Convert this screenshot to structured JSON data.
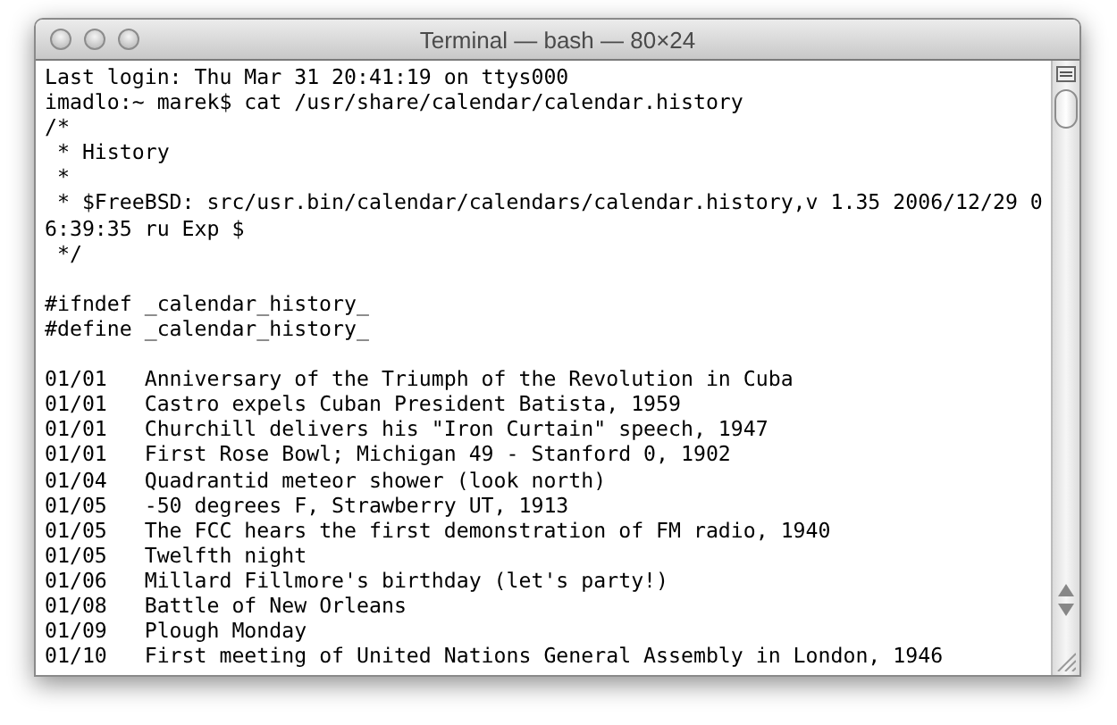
{
  "window": {
    "title": "Terminal — bash — 80×24"
  },
  "terminal": {
    "lines": [
      {
        "kind": "text",
        "text": "Last login: Thu Mar 31 20:41:19 on ttys000"
      },
      {
        "kind": "text",
        "text": "imadlo:~ marek$ cat /usr/share/calendar/calendar.history"
      },
      {
        "kind": "text",
        "text": "/*"
      },
      {
        "kind": "text",
        "text": " * History"
      },
      {
        "kind": "text",
        "text": " *"
      },
      {
        "kind": "text",
        "text": " * $FreeBSD: src/usr.bin/calendar/calendars/calendar.history,v 1.35 2006/12/29 0"
      },
      {
        "kind": "text",
        "text": "6:39:35 ru Exp $"
      },
      {
        "kind": "text",
        "text": " */"
      },
      {
        "kind": "blank"
      },
      {
        "kind": "text",
        "text": "#ifndef _calendar_history_"
      },
      {
        "kind": "text",
        "text": "#define _calendar_history_"
      },
      {
        "kind": "blank"
      },
      {
        "kind": "text",
        "text": "01/01\tAnniversary of the Triumph of the Revolution in Cuba"
      },
      {
        "kind": "text",
        "text": "01/01\tCastro expels Cuban President Batista, 1959"
      },
      {
        "kind": "text",
        "text": "01/01\tChurchill delivers his \"Iron Curtain\" speech, 1947"
      },
      {
        "kind": "text",
        "text": "01/01\tFirst Rose Bowl; Michigan 49 - Stanford 0, 1902"
      },
      {
        "kind": "text",
        "text": "01/04\tQuadrantid meteor shower (look north)"
      },
      {
        "kind": "text",
        "text": "01/05\t-50 degrees F, Strawberry UT, 1913"
      },
      {
        "kind": "text",
        "text": "01/05\tThe FCC hears the first demonstration of FM radio, 1940"
      },
      {
        "kind": "text",
        "text": "01/05\tTwelfth night"
      },
      {
        "kind": "text",
        "text": "01/06\tMillard Fillmore's birthday (let's party!)"
      },
      {
        "kind": "text",
        "text": "01/08\tBattle of New Orleans"
      },
      {
        "kind": "text",
        "text": "01/09\tPlough Monday"
      },
      {
        "kind": "text",
        "text": "01/10\tFirst meeting of United Nations General Assembly in London, 1946"
      }
    ]
  }
}
